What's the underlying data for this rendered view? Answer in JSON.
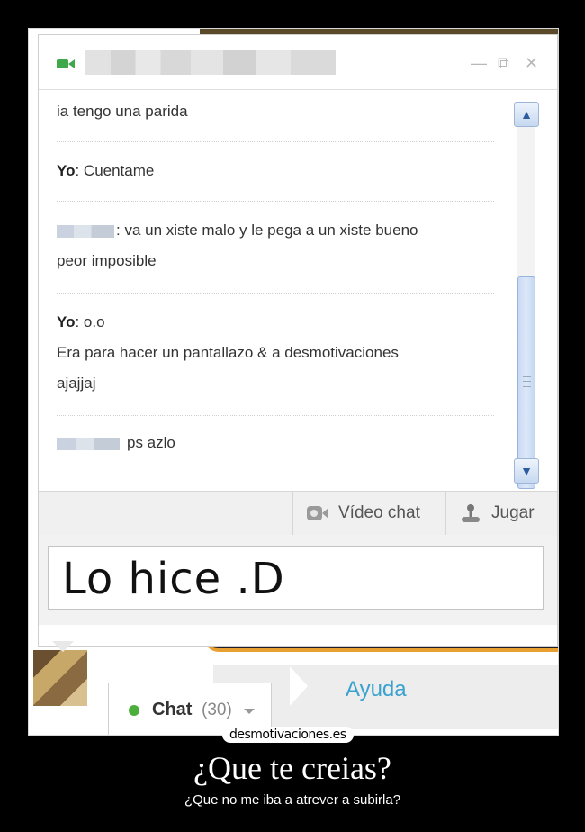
{
  "chat": {
    "window_controls": [
      "—",
      "⧉",
      "✕"
    ],
    "messages": [
      {
        "sender": "",
        "lines": [
          "ia tengo una parida"
        ]
      },
      {
        "sender": "Yo",
        "lines": [
          ": Cuentame"
        ]
      },
      {
        "sender": "",
        "lines": [
          ": va un xiste malo y le pega a un xiste bueno",
          "peor imposible"
        ]
      },
      {
        "sender": "Yo",
        "lines": [
          ": o.o",
          "Era para hacer un pantallazo & a desmotivaciones",
          "ajajjaj"
        ]
      },
      {
        "sender": "",
        "lines": [
          "ps azlo"
        ]
      }
    ],
    "toolbar": {
      "video_chat_label": "Vídeo chat",
      "play_label": "Jugar"
    },
    "input_value": "Lo hice .D"
  },
  "page": {
    "help_label": "Ayuda",
    "chat_tab_label": "Chat",
    "chat_tab_count": "(30)"
  },
  "poster": {
    "logo": "desmotivaciones.es",
    "title": "¿Que te creias?",
    "subtitle": "¿Que no me iba a atrever a subirla?"
  },
  "colors": {
    "status_online": "#4caf3c",
    "help_link": "#3aa2cf",
    "accent_orange": "#e8a030"
  },
  "icons": [
    "video-camera-icon",
    "minimize-icon",
    "popout-icon",
    "close-icon",
    "scroll-up-icon",
    "scroll-down-icon",
    "video-chat-icon",
    "joystick-icon",
    "status-online-icon",
    "dropdown-caret-icon"
  ]
}
